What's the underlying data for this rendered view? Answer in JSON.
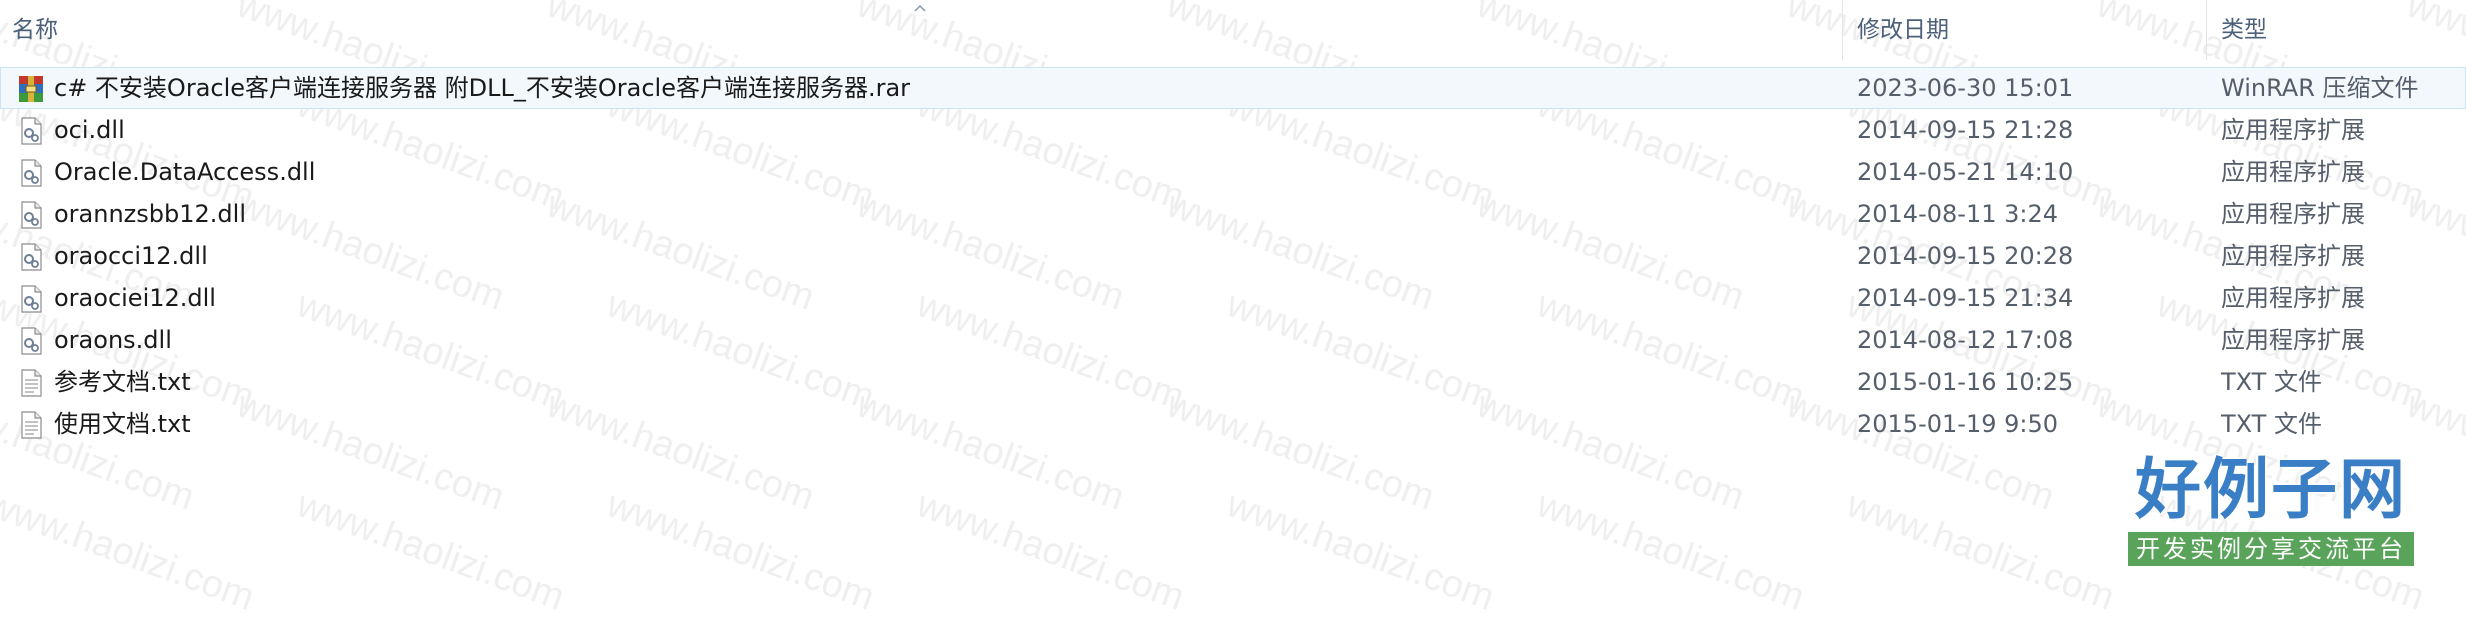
{
  "columns": {
    "name": "名称",
    "date_modified": "修改日期",
    "type": "类型"
  },
  "files": [
    {
      "name": "c# 不安装Oracle客户端连接服务器 附DLL_不安装Oracle客户端连接服务器.rar",
      "date": "2023-06-30 15:01",
      "type": "WinRAR 压缩文件",
      "icon": "winrar-archive-icon",
      "selected": true
    },
    {
      "name": "oci.dll",
      "date": "2014-09-15 21:28",
      "type": "应用程序扩展",
      "icon": "dll-file-icon"
    },
    {
      "name": "Oracle.DataAccess.dll",
      "date": "2014-05-21 14:10",
      "type": "应用程序扩展",
      "icon": "dll-file-icon"
    },
    {
      "name": "orannzsbb12.dll",
      "date": "2014-08-11 3:24",
      "type": "应用程序扩展",
      "icon": "dll-file-icon"
    },
    {
      "name": "oraocci12.dll",
      "date": "2014-09-15 20:28",
      "type": "应用程序扩展",
      "icon": "dll-file-icon"
    },
    {
      "name": "oraociei12.dll",
      "date": "2014-09-15 21:34",
      "type": "应用程序扩展",
      "icon": "dll-file-icon"
    },
    {
      "name": "oraons.dll",
      "date": "2014-08-12 17:08",
      "type": "应用程序扩展",
      "icon": "dll-file-icon"
    },
    {
      "name": "参考文档.txt",
      "date": "2015-01-16 10:25",
      "type": "TXT 文件",
      "icon": "text-file-icon"
    },
    {
      "name": "使用文档.txt",
      "date": "2015-01-19 9:50",
      "type": "TXT 文件",
      "icon": "text-file-icon"
    }
  ],
  "watermark_text": "www.haolizi.com",
  "logo": {
    "main": "好例子网",
    "sub": "开发实例分享交流平台"
  },
  "colors": {
    "header_text": "#4c607a",
    "selected_bg": "#f3f8fd",
    "logo_blue": "#3a7fc6",
    "logo_green": "#5aa35a"
  }
}
